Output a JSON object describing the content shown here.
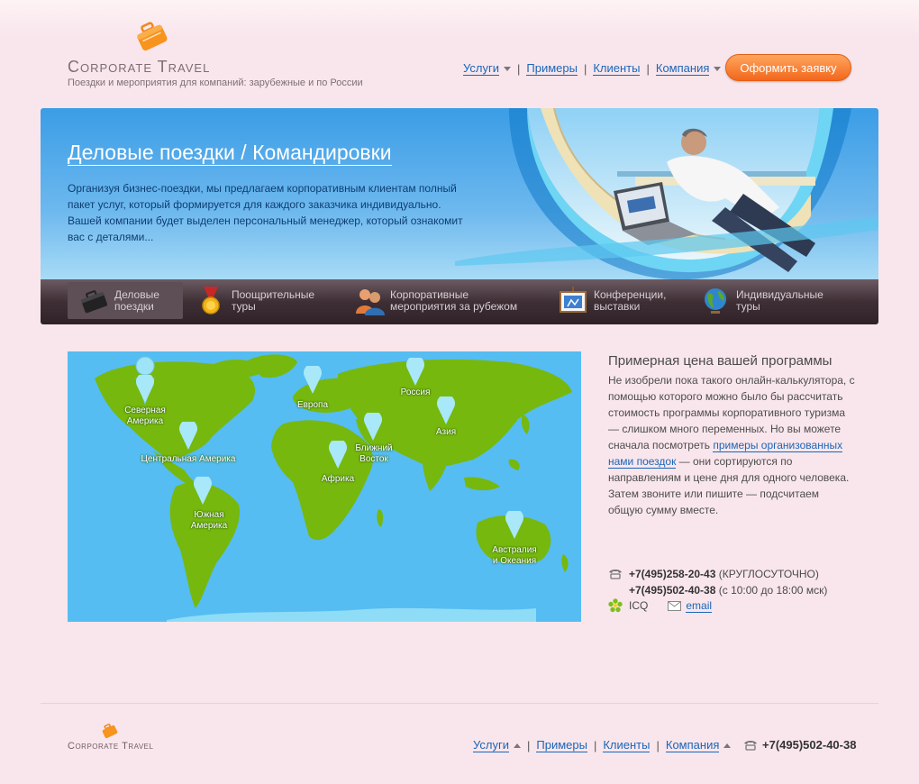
{
  "logo": {
    "title": "Corporate Travel",
    "subtitle": "Поездки и мероприятия для компаний: зарубежные и по России"
  },
  "topnav": {
    "items": [
      {
        "label": "Услуги",
        "has_dropdown": true
      },
      {
        "label": "Примеры",
        "has_dropdown": false
      },
      {
        "label": "Клиенты",
        "has_dropdown": false
      },
      {
        "label": "Компания",
        "has_dropdown": true
      }
    ],
    "order_button": "Оформить заявку"
  },
  "banner": {
    "title": "Деловые поездки / Командировки",
    "text": "Организуя бизнес-поездки, мы предлагаем корпоративным клиентам полный пакет услуг, который формируется для каждого заказчика индивидуально. Вашей компании будет выделен персональный менеджер, который ознакомит вас с деталями..."
  },
  "categories": [
    {
      "line1": "Деловые",
      "line2": "поездки",
      "icon": "briefcase-icon",
      "active": true
    },
    {
      "line1": "Поощрительные",
      "line2": "туры",
      "icon": "medal-icon",
      "active": false
    },
    {
      "line1": "Корпоративные",
      "line2": "мероприятия за рубежом",
      "icon": "people-icon",
      "active": false
    },
    {
      "line1": "Конференции,",
      "line2": "выставки",
      "icon": "presentation-board-icon",
      "active": false
    },
    {
      "line1": "Индивидуальные",
      "line2": "туры",
      "icon": "globe-icon",
      "active": false
    }
  ],
  "map": {
    "regions": [
      {
        "line1": "Северная",
        "line2": "Америка"
      },
      {
        "line1": "Центральная Америка",
        "line2": ""
      },
      {
        "line1": "Южная",
        "line2": "Америка"
      },
      {
        "line1": "Европа",
        "line2": ""
      },
      {
        "line1": "Африка",
        "line2": ""
      },
      {
        "line1": "Ближний",
        "line2": "Восток"
      },
      {
        "line1": "Россия",
        "line2": ""
      },
      {
        "line1": "Азия",
        "line2": ""
      },
      {
        "line1": "Австралия",
        "line2": "и Океания"
      }
    ]
  },
  "info": {
    "heading": "Примерная цена вашей программы",
    "text_before": "Не изобрели пока такого онлайн-калькулятора, с помощью которого можно было бы рассчитать стоимость программы корпоративного туризма — слишком много переменных. Но вы можете сначала посмотреть ",
    "link": "примеры организованных нами поездок",
    "text_after": " — они сортируются по направлениям и цене дня для одного человека. Затем звоните или пишите — подсчитаем общую сумму вместе."
  },
  "contacts": {
    "phone1": "+7(495)258-20-43",
    "phone1_note": "(КРУГЛОСУТОЧНО)",
    "phone2": "+7(495)502-40-38",
    "phone2_note": "(с 10:00 до 18:00 мск)",
    "icq": "ICQ",
    "email": "email"
  },
  "footer": {
    "logo": "Corporate Travel",
    "nav": [
      {
        "label": "Услуги",
        "has_dropdown": true
      },
      {
        "label": "Примеры",
        "has_dropdown": false
      },
      {
        "label": "Клиенты",
        "has_dropdown": false
      },
      {
        "label": "Компания",
        "has_dropdown": true
      }
    ],
    "phone": "+7(495)502-40-38"
  },
  "colors": {
    "background": "#f9e6ec",
    "link": "#1a66b8",
    "accent_button": "#f2671c",
    "banner_blue": "#3b9de6",
    "map_water": "#55bdf1",
    "map_land": "#76b80d",
    "category_bar": "#3e2f35"
  }
}
